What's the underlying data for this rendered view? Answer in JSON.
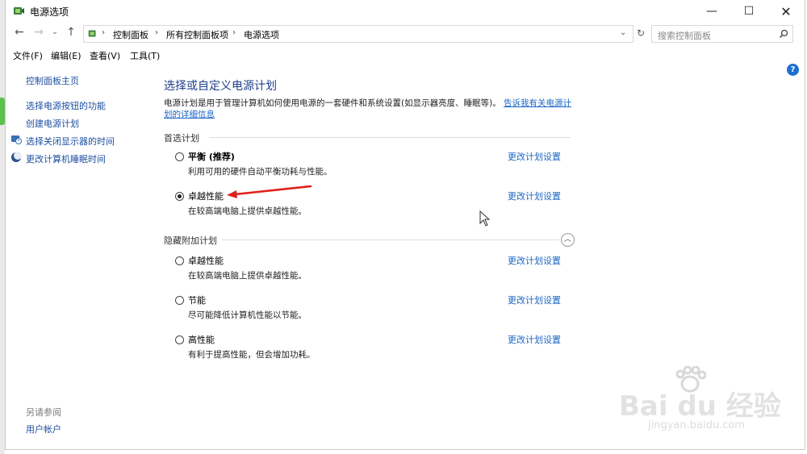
{
  "window": {
    "title": "电源选项"
  },
  "address": {
    "crumbs": [
      "控制面板",
      "所有控制面板项",
      "电源选项"
    ],
    "search_placeholder": "搜索控制面板"
  },
  "menu": [
    "文件(F)",
    "编辑(E)",
    "查看(V)",
    "工具(T)"
  ],
  "sidebar": {
    "home": "控制面板主页",
    "links": [
      "选择电源按钮的功能",
      "创建电源计划",
      "选择关闭显示器的时间",
      "更改计算机睡眠时间"
    ],
    "see_also_title": "另请参阅",
    "see_also_links": [
      "用户帐户"
    ]
  },
  "main": {
    "title": "选择或自定义电源计划",
    "description": "电源计划是用于管理计算机如何使用电源的一套硬件和系统设置(如显示器亮度、睡眠等)。",
    "learn_more_line1": "告诉我有关电源计",
    "learn_more_line2": "划的详细信息",
    "preferred_label": "首选计划",
    "hidden_label": "隐藏附加计划",
    "change_link": "更改计划设置",
    "preferred_plans": [
      {
        "name": "平衡 (推荐)",
        "desc": "利用可用的硬件自动平衡功耗与性能。",
        "selected": false
      },
      {
        "name": "卓越性能",
        "desc": "在较高端电脑上提供卓越性能。",
        "selected": true
      }
    ],
    "hidden_plans": [
      {
        "name": "卓越性能",
        "desc": "在较高端电脑上提供卓越性能。",
        "selected": false
      },
      {
        "name": "节能",
        "desc": "尽可能降低计算机性能以节能。",
        "selected": false
      },
      {
        "name": "高性能",
        "desc": "有利于提高性能，但会增加功耗。",
        "selected": false
      }
    ]
  },
  "watermark": {
    "brand": "Bai du 经验",
    "url": "jingyan.baidu.com"
  },
  "colors": {
    "link": "#1c66c4",
    "annotation_arrow": "#e0201c"
  },
  "icons": [
    "power-options-icon",
    "back-arrow-icon",
    "forward-arrow-icon",
    "up-arrow-icon",
    "refresh-icon",
    "search-icon",
    "help-icon",
    "display-clock-icon",
    "moon-icon",
    "chevron-up-icon"
  ]
}
